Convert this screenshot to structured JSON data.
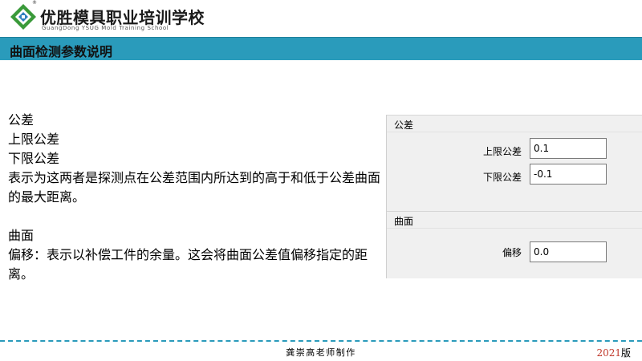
{
  "header": {
    "school_name": "优胜模具职业培训学校",
    "school_en": "GuangDong YSUG Mold Training School",
    "reg_mark": "®"
  },
  "title": "曲面检测参数说明",
  "body": {
    "line1": "公差",
    "line2": "上限公差",
    "line3": "下限公差",
    "line4": "表示为这两者是探测点在公差范围内所达到的高于和低于公差曲面的最大距离。",
    "line5": "曲面",
    "line6": "偏移：表示以补偿工件的余量。这会将曲面公差值偏移指定的距离。"
  },
  "panel": {
    "tolerance_group_title": "公差",
    "upper_label": "上限公差",
    "upper_value": "0.1",
    "lower_label": "下限公差",
    "lower_value": "-0.1",
    "surface_group_title": "曲面",
    "offset_label": "偏移",
    "offset_value": "0.0"
  },
  "footer": {
    "author": "龚崇高老师制作",
    "year": "2021",
    "edition": "版"
  },
  "colors": {
    "title_bar": "#2a9bbb",
    "logo_green": "#3a9a3a",
    "year_red": "#c0392b"
  }
}
